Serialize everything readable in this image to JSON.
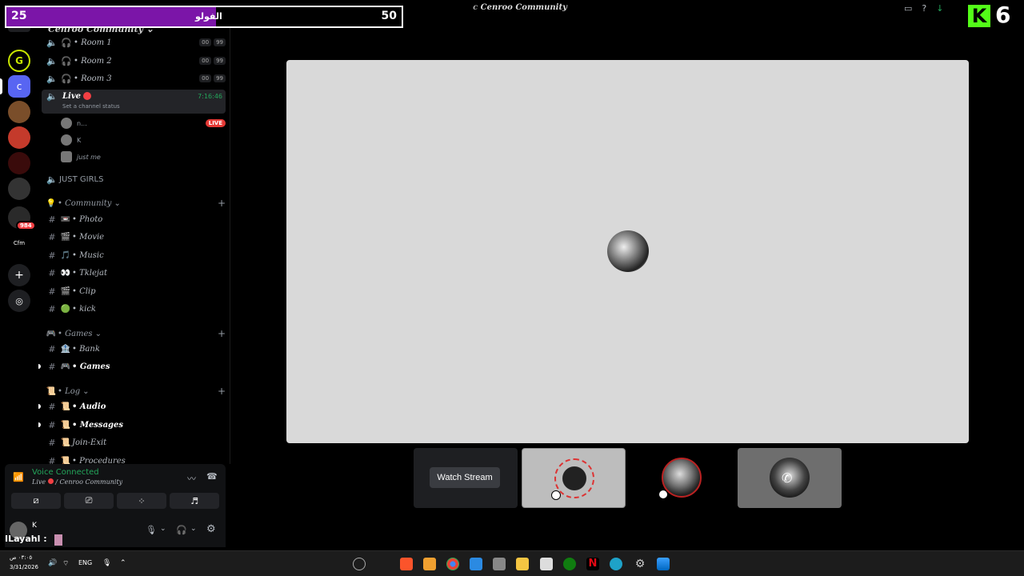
{
  "overlay": {
    "left_count": "25",
    "label": "الفولو",
    "right_count": "50",
    "k_logo": "K",
    "k_count": "6"
  },
  "window": {
    "title": "Cenroo Community"
  },
  "server": {
    "name": "Cenroo Community"
  },
  "rail": {
    "badge": "984",
    "cfm_label": "Cfm"
  },
  "channels": {
    "voice": [
      {
        "name": "• Room 1",
        "a": "00",
        "b": "99"
      },
      {
        "name": "• Room 2",
        "a": "00",
        "b": "99"
      },
      {
        "name": "• Room 3",
        "a": "00",
        "b": "99"
      }
    ],
    "live": {
      "name": "Live",
      "timer": "7:16:46",
      "status": "Set a channel status"
    },
    "live_users": [
      {
        "name": "n...",
        "tag": "LIVE"
      },
      {
        "name": "K"
      },
      {
        "name": "just me"
      }
    ],
    "just_girls": "JUST GIRLS",
    "community_cat": "• Community",
    "community": [
      {
        "emoji": "📼",
        "name": "• Photo"
      },
      {
        "emoji": "🎬",
        "name": "• Movie"
      },
      {
        "emoji": "🎵",
        "name": "• Music"
      },
      {
        "emoji": "👀",
        "name": "• Tklejat"
      },
      {
        "emoji": "🎬",
        "name": "• Clip"
      },
      {
        "emoji": "🟢",
        "name": "• kick"
      }
    ],
    "games_cat": "• Games",
    "games": [
      {
        "emoji": "🏦",
        "name": "• Bank"
      },
      {
        "emoji": "🎮",
        "name": "• Games"
      }
    ],
    "log_cat": "• Log",
    "log": [
      {
        "emoji": "📜",
        "name": "• Audio"
      },
      {
        "emoji": "📜",
        "name": "• Messages"
      },
      {
        "emoji": "📜",
        "name": "Join-Exit"
      },
      {
        "emoji": "📜",
        "name": "• Procedures"
      }
    ]
  },
  "voice_panel": {
    "status": "Voice Connected",
    "location": "Live",
    "server": "/ Cenroo Community"
  },
  "user_panel": {
    "name": "K",
    "overlay_name": "ILayahl :"
  },
  "stage": {
    "watch_label": "Watch Stream"
  },
  "taskbar": {
    "time": "٠٣:٠٥ ص",
    "date": "3/31/2026",
    "lang": "ENG"
  }
}
